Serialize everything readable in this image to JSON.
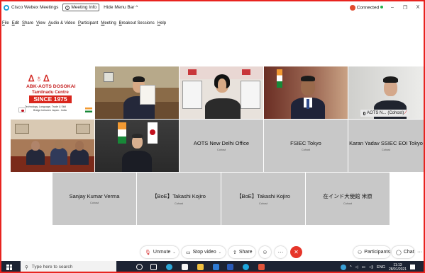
{
  "titlebar": {
    "app_title": "Cisco Webex Meetings",
    "meeting_info": "Meeting Info",
    "hide_menu": "Hide Menu Bar ^",
    "status": "Connected",
    "minimize": "–",
    "restore": "❐",
    "close": "X"
  },
  "menu": {
    "items": [
      "File",
      "Edit",
      "Share",
      "View",
      "Audio & Video",
      "Participant",
      "Meeting",
      "Breakout Sessions",
      "Help"
    ]
  },
  "logo_tile": {
    "line1": "ABK-AOTS DOSOKAI",
    "line2": "Tamilnadu Centre",
    "since": "SINCE 1975",
    "line3": "Technology, Language, Trade & Skill",
    "line4": "Bridge between Japan - India"
  },
  "active_badge": {
    "name": "AOTS N...",
    "role": "(Cohost)"
  },
  "tiles_row2": [
    {
      "name": "AOTS New Delhi Office",
      "role": "Cohost"
    },
    {
      "name": "FSIEC Tokyo",
      "role": "Cohost"
    },
    {
      "name": "Karan Yadav SSIEC EOI Tokyo",
      "role": "Cohost"
    }
  ],
  "tiles_row3": [
    {
      "name": "Sanjay Kumar Verma",
      "role": "Cohost"
    },
    {
      "name": "【BoE】Takashi Kojiro",
      "role": "Cohost"
    },
    {
      "name": "【BoE】Takashi Kojiro",
      "role": "Cohost"
    },
    {
      "name": "在インド大使館 米原",
      "role": "Cohost"
    }
  ],
  "toolbar": {
    "unmute": "Unmute",
    "stop_video": "Stop video",
    "share": "Share",
    "reactions": "☺",
    "more": "···",
    "leave": "✕",
    "participants": "Participants",
    "chat": "Chat",
    "overflow": "···"
  },
  "taskbar": {
    "search_placeholder": "Type here to search",
    "lang": "ENG",
    "time": "11:13",
    "date": "28/01/2021"
  },
  "colors": {
    "frame_red": "#e8231f",
    "tile_gray": "#c8c8c8",
    "leave_red": "#e6352a",
    "taskbar": "#1c2333"
  }
}
